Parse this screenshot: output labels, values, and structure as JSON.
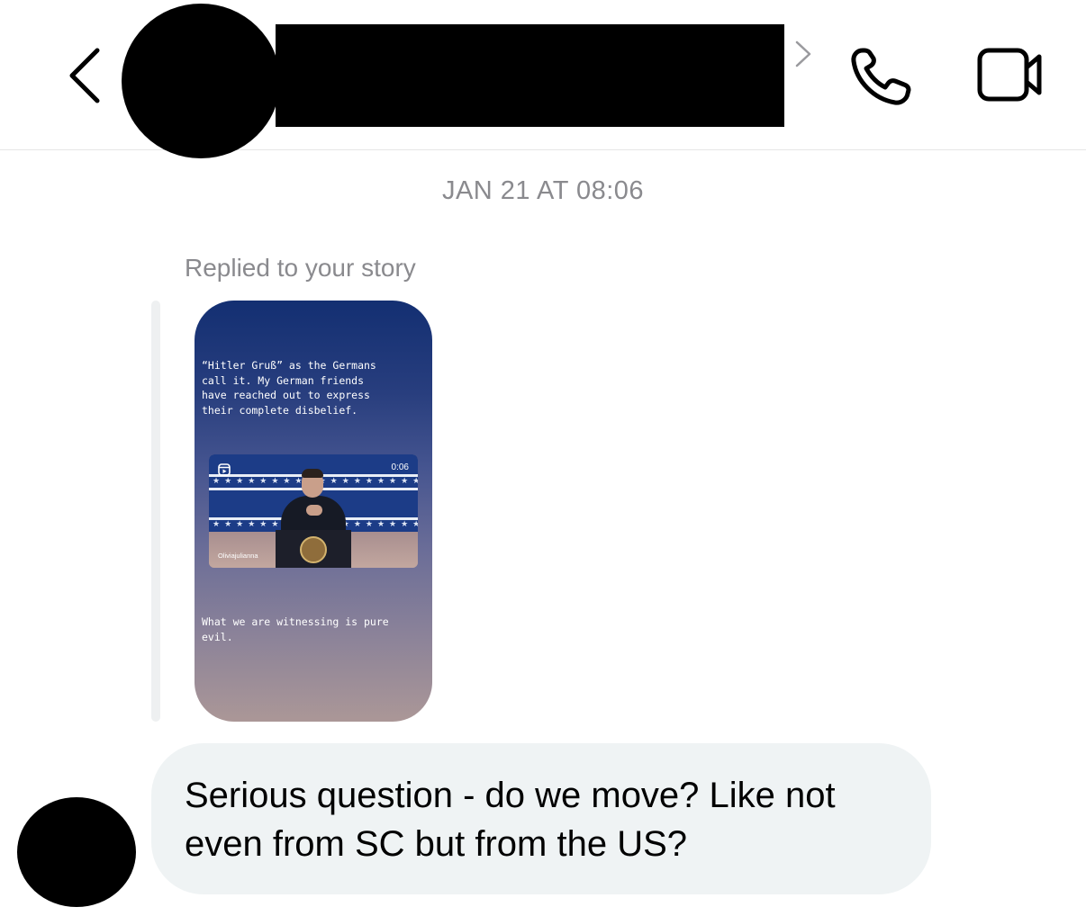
{
  "header": {
    "back_icon": "chevron-left-icon",
    "profile_avatar": "redacted",
    "contact_name": "",
    "details_chevron_icon": "chevron-right-icon",
    "call_icon": "phone-icon",
    "video_icon": "video-camera-icon"
  },
  "thread": {
    "timestamp": "JAN 21 AT 08:06",
    "story_reply": {
      "label": "Replied to your story",
      "story": {
        "top_text": "“Hitler Gruß” as the Germans\ncall it. My German friends\nhave reached out to express\ntheir complete disbelief.",
        "reel_duration": "0:06",
        "reel_username": "Oliviajulianna",
        "bottom_text": "What we are witnessing is pure\nevil."
      }
    },
    "message": {
      "text": "Serious question - do we move? Like not even from SC but from the US?"
    }
  },
  "colors": {
    "bubble": "#eff3f4",
    "meta_text": "#8a8a8e",
    "story_gradient_top": "#132f72",
    "story_gradient_bottom": "#ab9797"
  }
}
